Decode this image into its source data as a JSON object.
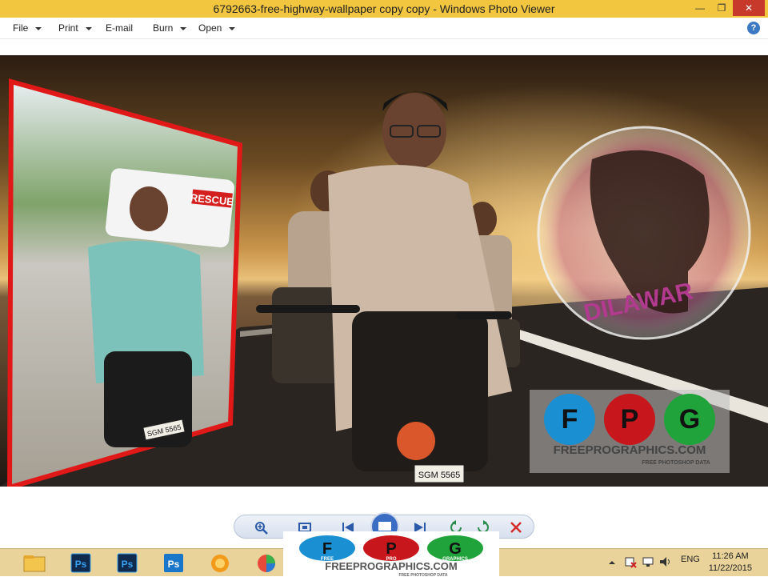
{
  "window": {
    "title": "6792663-free-highway-wallpaper copy copy - Windows Photo Viewer"
  },
  "menu": {
    "file": "File",
    "print": "Print",
    "email": "E-mail",
    "burn": "Burn",
    "open": "Open",
    "help": "?"
  },
  "photo": {
    "badge_text": "RESCUE",
    "plate_left": "SGM 5565",
    "plate_main": "SGM 5565",
    "logo_text": "DILAWAR",
    "watermark": {
      "f": "F",
      "f_sub": "FREE",
      "p": "P",
      "p_sub": "PRO",
      "g": "G",
      "g_sub": "GRAPHICS",
      "site": "FREEPROGRAPHICS.COM",
      "tagline": "FREE PHOTOSHOP DATA"
    }
  },
  "taskbar": {
    "tray_lang": "ENG",
    "time": "11:26 AM",
    "date": "11/22/2015"
  },
  "colors": {
    "titlebar": "#f2c63f",
    "taskbar": "#e9d39b",
    "frame_border": "#e01818",
    "wm_blue": "#1a8fd1",
    "wm_red": "#c8161d",
    "wm_green": "#1fa33a"
  }
}
